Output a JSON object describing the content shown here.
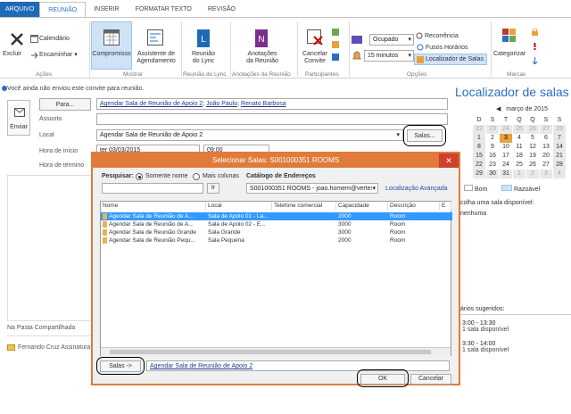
{
  "tabs": [
    "ARQUIVO",
    "REUNIÃO",
    "INSERIR",
    "FORMATAR TEXTO",
    "REVISÃO"
  ],
  "ribbon": {
    "excluir": "Excluir",
    "calendario": "Calendário",
    "encaminhar": "Encaminhar",
    "compromisso": "Compromisso",
    "assistente": "Assistente de\nAgendamento",
    "lync": "Reunião\ndo Lync",
    "anotacoes": "Anotações\nda Reunião",
    "cancelar": "Cancelar\nConvite",
    "ocupado": "Ocupado",
    "minutos": "15 minutos",
    "recorrencia": "Recorrência",
    "fusos": "Fusos Horários",
    "localizador": "Localizador de Salas",
    "categorizar": "Categorizar",
    "groups": {
      "acoes": "Ações",
      "mostrar": "Mostrar",
      "lync": "Reunião do Lync",
      "anot": "Anotações da Reunião",
      "part": "Participantes",
      "opcoes": "Opções",
      "marcas": "Marcas"
    }
  },
  "appointment": {
    "warning": "Você ainda não enviou este convite para reunião.",
    "send": "Enviar",
    "to_button": "Para...",
    "to_value": [
      "Agendar Sala de Reunião de Apoio 2",
      "João Paulo",
      "Renato Barbosa"
    ],
    "subject_label": "Assunto",
    "location_label": "Local",
    "location_value": "Agendar Sala de Reunião de Apoio 2",
    "salas_button": "Salas...",
    "start_label": "Hora de início",
    "end_label": "Hora de término",
    "start_date": "ter 03/03/2015",
    "start_time": "09:00",
    "shared_folder": "Na Pasta Compartilhada",
    "user": "Fernando Cruz Assinatura"
  },
  "side": {
    "title": "Localizador de salas",
    "month": "março de 2015",
    "weekdays": [
      "D",
      "S",
      "T",
      "Q",
      "Q",
      "S",
      "S"
    ],
    "days": [
      [
        "22",
        "23",
        "24",
        "25",
        "26",
        "27",
        "28"
      ],
      [
        "1",
        "2",
        "3",
        "4",
        "5",
        "6",
        "7"
      ],
      [
        "8",
        "9",
        "10",
        "11",
        "12",
        "13",
        "14"
      ],
      [
        "15",
        "16",
        "17",
        "18",
        "19",
        "20",
        "21"
      ],
      [
        "22",
        "23",
        "24",
        "25",
        "26",
        "27",
        "28"
      ],
      [
        "29",
        "30",
        "31",
        "1",
        "2",
        "3",
        "4"
      ]
    ],
    "legend_good": "Bom",
    "legend_fair": "Razoável",
    "choose": "colha uma sala disponível:",
    "none": "nenhuma",
    "suggested": "ários sugeridos:",
    "slots": [
      {
        "time": "3:00 - 13:30",
        "desc": "1 sala disponível"
      },
      {
        "time": "3:30 - 14:00",
        "desc": "1 sala disponível"
      }
    ]
  },
  "dialog": {
    "title": "Selecionar Salas: S001000351 ROOMS",
    "search_label": "Pesquisar:",
    "opt_name": "Somente nome",
    "opt_more": "Mais colunas",
    "address_book_label": "Catálogo de Endereços",
    "go": "Ir",
    "address_book": "S001000351 ROOMS - joao.homem@vertex",
    "advanced": "Localização Avançada",
    "columns": [
      "Nome",
      "Local",
      "Telefone comercial",
      "Capacidade",
      "Descrição",
      "E"
    ],
    "rows": [
      [
        "Agendar Sala de Reunião de A...",
        "Sala de Apoio 01 - La...",
        "",
        "2000",
        "Room"
      ],
      [
        "Agendar Sala de Reunião de A...",
        "Sala de Apoio 02 - E...",
        "",
        "3000",
        "Room"
      ],
      [
        "Agendar Sala de Reunião Grande",
        "Sala Grande",
        "",
        "3000",
        "Room"
      ],
      [
        "Agendar Sala de Reunião Pequ...",
        "Sala Pequena",
        "",
        "2000",
        "Room"
      ]
    ],
    "salas_button": "Salas ->",
    "selected": "Agendar Sala de Reunião de Apoio 2",
    "ok": "OK",
    "cancel": "Cancelar"
  }
}
